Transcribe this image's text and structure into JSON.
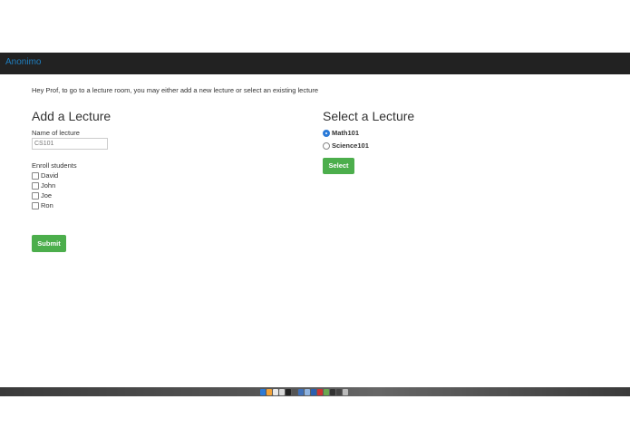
{
  "navbar": {
    "brand": "Anonimo"
  },
  "intro_text": "Hey Prof, to go to a lecture room, you may either add a new lecture or select an existing lecture",
  "add_lecture": {
    "heading": "Add a Lecture",
    "name_label": "Name of lecture",
    "name_placeholder": "CS101",
    "enroll_label": "Enroll students",
    "students": [
      {
        "name": "David",
        "checked": false
      },
      {
        "name": "John",
        "checked": false
      },
      {
        "name": "Joe",
        "checked": false
      },
      {
        "name": "Ron",
        "checked": false
      }
    ],
    "submit_label": "Submit"
  },
  "select_lecture": {
    "heading": "Select a Lecture",
    "lectures": [
      {
        "name": "Math101",
        "selected": true
      },
      {
        "name": "Science101",
        "selected": false
      }
    ],
    "select_label": "Select"
  },
  "dock": {
    "icons": [
      "finder-icon",
      "safari-icon",
      "chrome-icon",
      "notes-icon",
      "terminal-icon",
      "calendar-icon",
      "app-icon",
      "mail-icon",
      "word-icon",
      "app-icon-2",
      "app-icon-3",
      "screen-icon",
      "monitor-icon",
      "trash-icon"
    ],
    "icon_colors": [
      "#2d7ad6",
      "#f2a33a",
      "#e8e8e8",
      "#d9d9d9",
      "#222222",
      "#555555",
      "#3f6fb7",
      "#8fb3e0",
      "#2b5fb0",
      "#cc3333",
      "#6aa84f",
      "#333333",
      "#444444",
      "#bbbbbb"
    ]
  },
  "colors": {
    "accent_green": "#4cae4c",
    "brand_blue": "#1f7fc0",
    "navbar": "#222222",
    "radio_blue": "#2a7ad8"
  }
}
